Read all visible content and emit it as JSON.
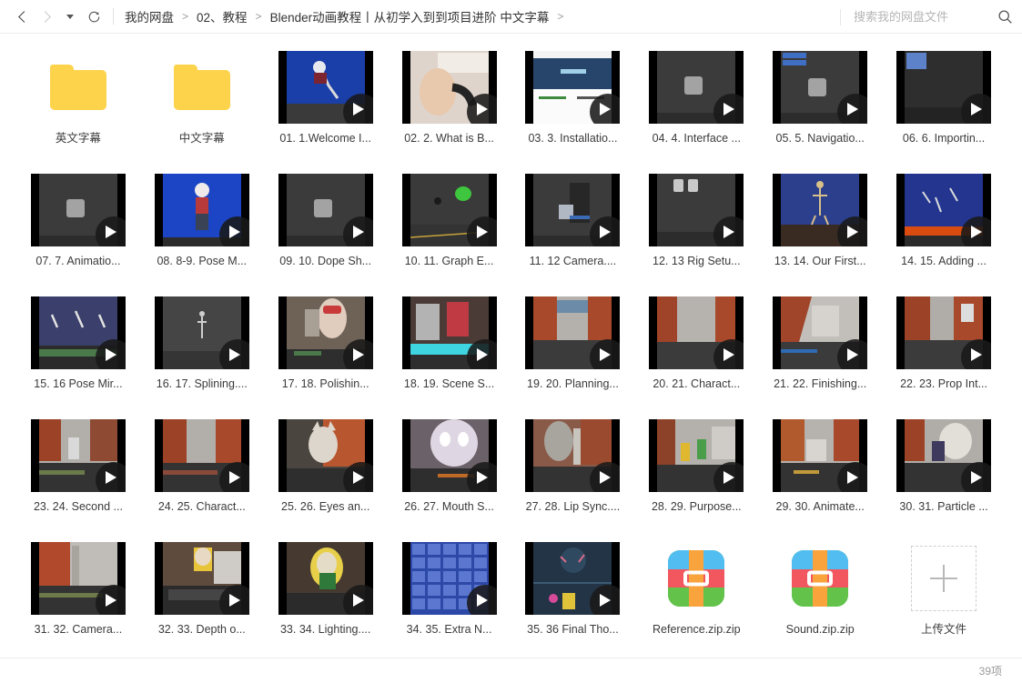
{
  "topbar": {
    "back_icon": "chevron-left-icon",
    "forward_icon": "chevron-right-icon",
    "history_icon": "caret-down-icon",
    "refresh_icon": "refresh-icon",
    "breadcrumb": [
      {
        "label": "我的网盘"
      },
      {
        "label": "02、教程"
      },
      {
        "label": "Blender动画教程丨从初学入到到项目进阶 中文字幕"
      }
    ],
    "breadcrumb_sep": ">",
    "search": {
      "placeholder": "搜索我的网盘文件",
      "value": "",
      "icon": "search-icon"
    }
  },
  "statusbar": {
    "count_label": "39项"
  },
  "items": [
    {
      "name": "英文字幕",
      "kind": "folder"
    },
    {
      "name": "中文字幕",
      "kind": "folder"
    },
    {
      "name": "01. 1.Welcome I...",
      "kind": "video",
      "bg": "#1b3fa8",
      "art": "char-blue"
    },
    {
      "name": "02. 2. What is B...",
      "kind": "video",
      "bg": "#d8cfc6",
      "art": "photo-gym"
    },
    {
      "name": "03. 3. Installatio...",
      "kind": "video",
      "bg": "#2a3a52",
      "art": "webpage"
    },
    {
      "name": "04. 4. Interface ...",
      "kind": "video",
      "bg": "#3b3b3b",
      "art": "cube"
    },
    {
      "name": "05. 5. Navigatio...",
      "kind": "video",
      "bg": "#3b3b3b",
      "art": "cube-menu"
    },
    {
      "name": "06. 6. Importin...",
      "kind": "video",
      "bg": "#2e2e2e",
      "art": "panel-tl"
    },
    {
      "name": "07. 7. Animatio...",
      "kind": "video",
      "bg": "#3b3b3b",
      "art": "cube"
    },
    {
      "name": "08. 8-9. Pose M...",
      "kind": "video",
      "bg": "#1b45c4",
      "art": "char-front"
    },
    {
      "name": "09. 10. Dope Sh...",
      "kind": "video",
      "bg": "#3b3b3b",
      "art": "cube"
    },
    {
      "name": "10. 11. Graph E...",
      "kind": "video",
      "bg": "#3a3a3a",
      "art": "green-blob"
    },
    {
      "name": "11. 12 Camera....",
      "kind": "video",
      "bg": "#3b3b3b",
      "art": "cube-list"
    },
    {
      "name": "12. 13 Rig Setu...",
      "kind": "video",
      "bg": "#3b3b3b",
      "art": "two-cubes"
    },
    {
      "name": "13. 14. Our First...",
      "kind": "video",
      "bg": "#2b3f8c",
      "art": "rig-grid"
    },
    {
      "name": "14. 15. Adding ...",
      "kind": "video",
      "bg": "#23358f",
      "art": "rig-speed"
    },
    {
      "name": "15. 16 Pose Mir...",
      "kind": "video",
      "bg": "#3a3f6b",
      "art": "run-cycle"
    },
    {
      "name": "16. 17. Splining....",
      "kind": "video",
      "bg": "#454545",
      "art": "thin-char"
    },
    {
      "name": "17. 18. Polishin...",
      "kind": "video",
      "bg": "#6e6257",
      "art": "ref-video"
    },
    {
      "name": "18. 19. Scene S...",
      "kind": "video",
      "bg": "#4a3b36",
      "art": "scene-cyan"
    },
    {
      "name": "19. 20. Planning...",
      "kind": "video",
      "bg": "#9a5a42",
      "art": "street"
    },
    {
      "name": "20. 21. Charact...",
      "kind": "video",
      "bg": "#9a5a42",
      "art": "street2"
    },
    {
      "name": "21. 22. Finishing...",
      "kind": "video",
      "bg": "#8e5038",
      "art": "street3"
    },
    {
      "name": "22. 23. Prop Int...",
      "kind": "video",
      "bg": "#97553d",
      "art": "street4"
    },
    {
      "name": "23. 24. Second ...",
      "kind": "video",
      "bg": "#8c5139",
      "art": "alley-char"
    },
    {
      "name": "24. 25. Charact...",
      "kind": "video",
      "bg": "#8c5139",
      "art": "alley2"
    },
    {
      "name": "25. 26. Eyes an...",
      "kind": "video",
      "bg": "#4b4540",
      "art": "closeup-cat"
    },
    {
      "name": "26. 27. Mouth S...",
      "kind": "video",
      "bg": "#6b6168",
      "art": "face-closeup"
    },
    {
      "name": "27. 28. Lip Sync....",
      "kind": "video",
      "bg": "#8a5a48",
      "art": "prop-closeup"
    },
    {
      "name": "28. 29. Purpose...",
      "kind": "video",
      "bg": "#7d5a46",
      "art": "street-color"
    },
    {
      "name": "29. 30. Animate...",
      "kind": "video",
      "bg": "#8b5f49",
      "art": "street5"
    },
    {
      "name": "30. 31. Particle ...",
      "kind": "video",
      "bg": "#7e5140",
      "art": "char-bag"
    },
    {
      "name": "31. 32. Camera...",
      "kind": "video",
      "bg": "#8a4f3c",
      "art": "red-wall"
    },
    {
      "name": "32. 33. Depth o...",
      "kind": "video",
      "bg": "#5e4b3d",
      "art": "stage-char"
    },
    {
      "name": "33. 34. Lighting....",
      "kind": "video",
      "bg": "#463a30",
      "art": "lit-char"
    },
    {
      "name": "34. 35. Extra N...",
      "kind": "video",
      "bg": "#2d49a8",
      "art": "contact-sheet"
    },
    {
      "name": "35. 36 Final Tho...",
      "kind": "video",
      "bg": "#223445",
      "art": "final-night"
    },
    {
      "name": "Reference.zip.zip",
      "kind": "zip"
    },
    {
      "name": "Sound.zip.zip",
      "kind": "zip"
    },
    {
      "name": "上传文件",
      "kind": "upload"
    }
  ]
}
